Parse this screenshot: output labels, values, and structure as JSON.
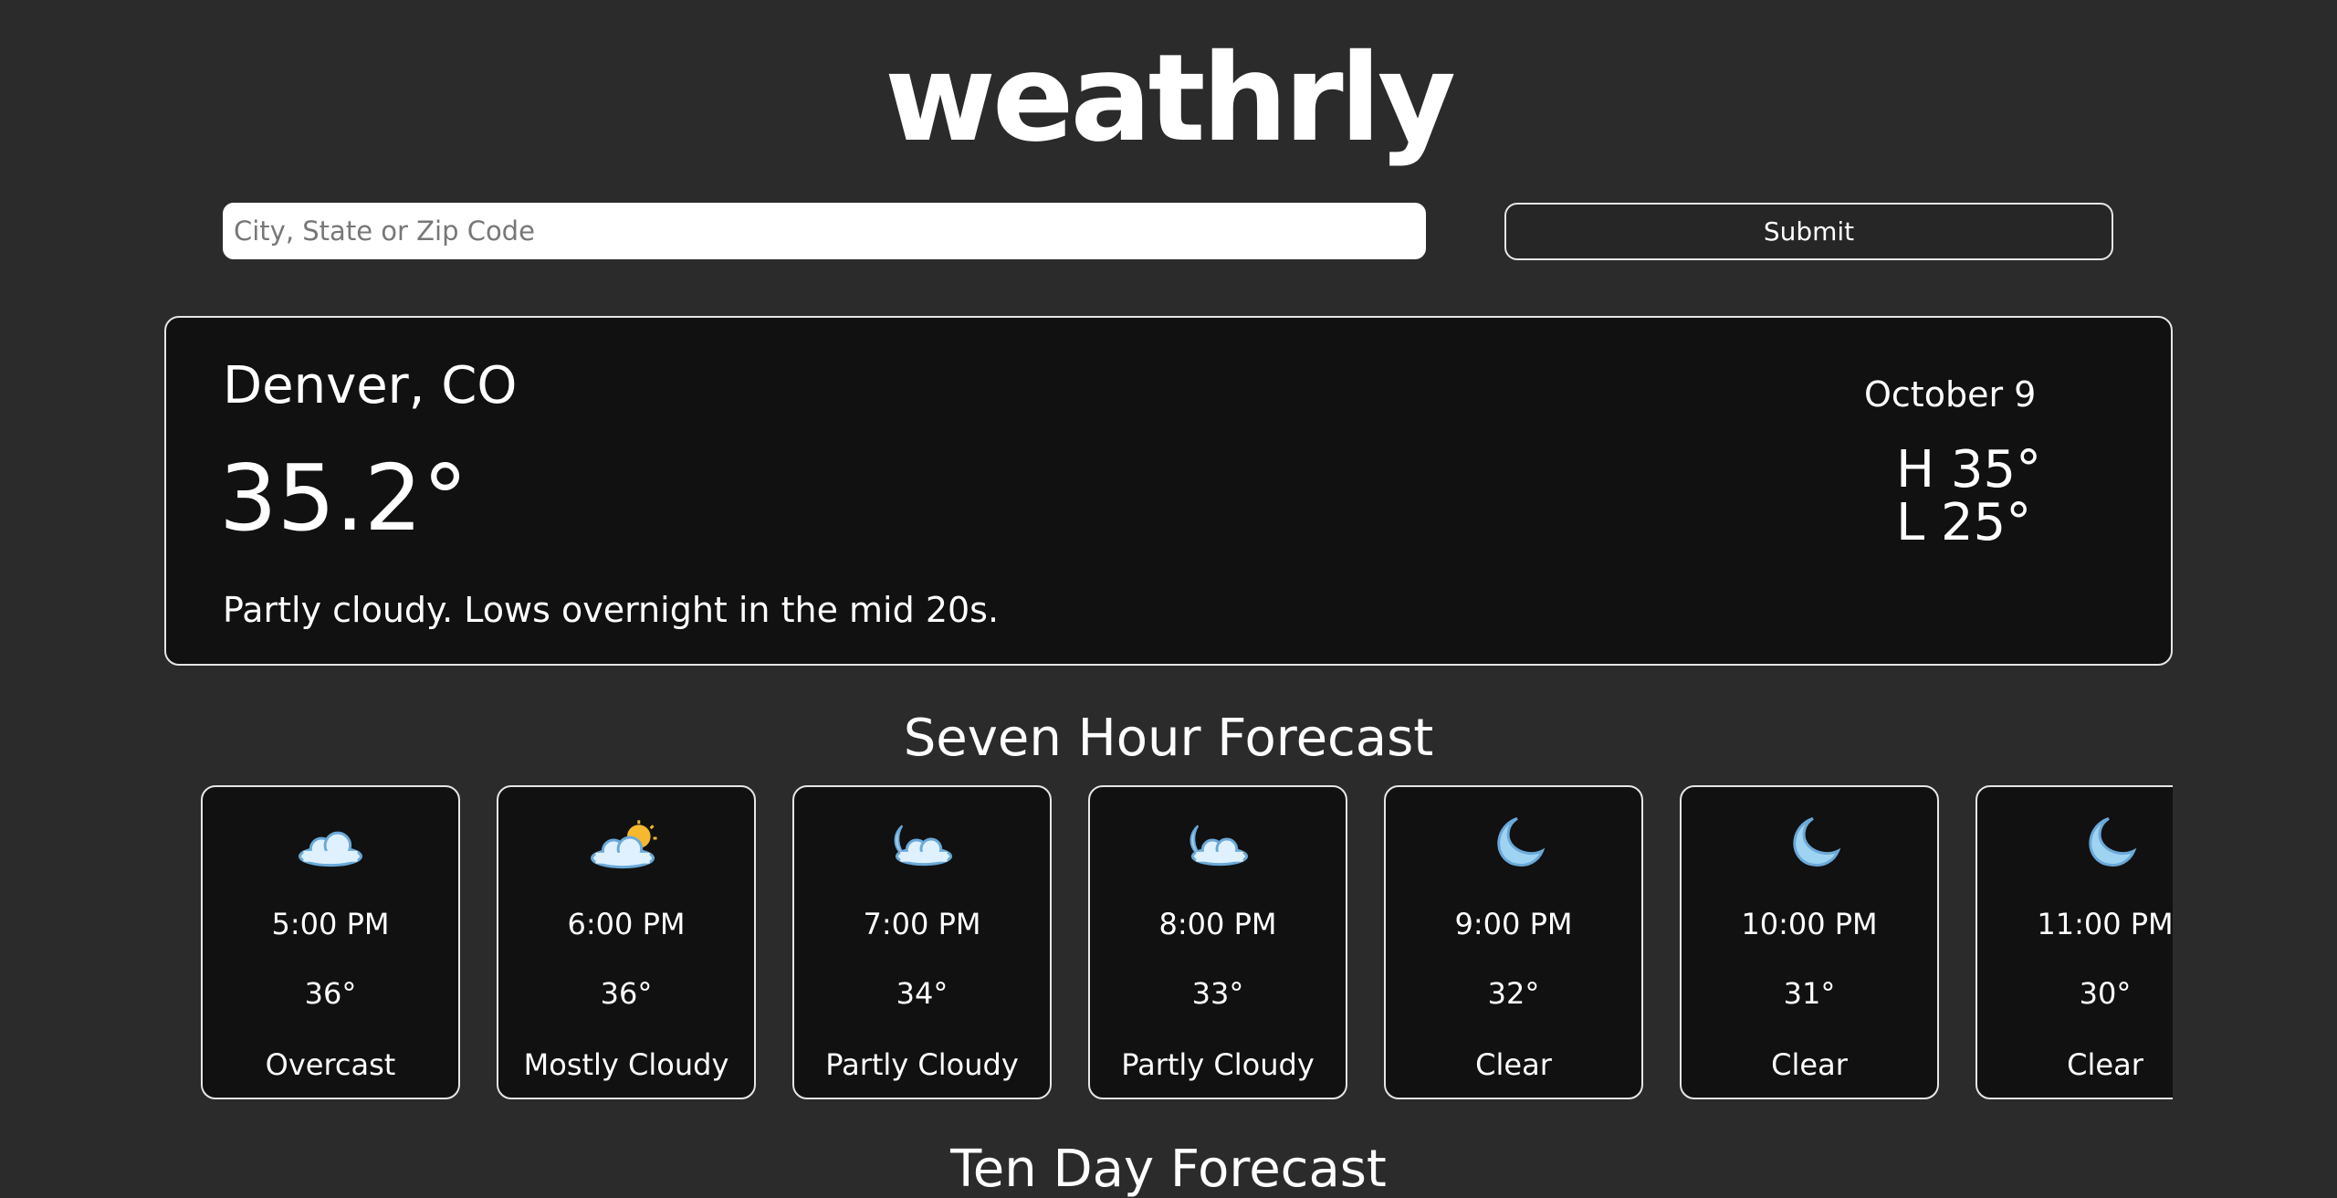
{
  "app": {
    "title": "weathrly"
  },
  "search": {
    "placeholder": "City, State or Zip Code",
    "value": "",
    "submit_label": "Submit"
  },
  "current": {
    "location": "Denver, CO",
    "temperature": "35.2°",
    "summary": "Partly cloudy. Lows overnight in the mid 20s.",
    "date": "October 9",
    "high": "H 35°",
    "low": "L 25°"
  },
  "hourly": {
    "title": "Seven Hour Forecast",
    "items": [
      {
        "time": "5:00 PM",
        "temp": "36°",
        "condition": "Overcast",
        "icon": "cloud-icon"
      },
      {
        "time": "6:00 PM",
        "temp": "36°",
        "condition": "Mostly Cloudy",
        "icon": "sun-behind-cloud-icon"
      },
      {
        "time": "7:00 PM",
        "temp": "34°",
        "condition": "Partly Cloudy",
        "icon": "moon-cloud-icon"
      },
      {
        "time": "8:00 PM",
        "temp": "33°",
        "condition": "Partly Cloudy",
        "icon": "moon-cloud-icon"
      },
      {
        "time": "9:00 PM",
        "temp": "32°",
        "condition": "Clear",
        "icon": "crescent-moon-icon"
      },
      {
        "time": "10:00 PM",
        "temp": "31°",
        "condition": "Clear",
        "icon": "crescent-moon-icon"
      },
      {
        "time": "11:00 PM",
        "temp": "30°",
        "condition": "Clear",
        "icon": "crescent-moon-icon"
      }
    ]
  },
  "ten_day": {
    "title": "Ten Day Forecast"
  },
  "colors": {
    "background": "#2b2b2b",
    "card": "#111111",
    "border": "#e6e6e6",
    "text": "#ffffff",
    "cloud": "#dff1ff",
    "cloud_outline": "#6aa9d8",
    "moon": "#9fd3f2",
    "sun": "#f5b82e"
  }
}
